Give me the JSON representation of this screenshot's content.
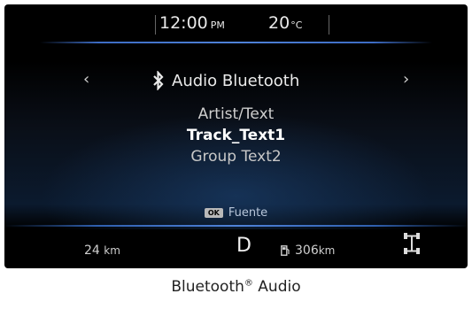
{
  "status_bar": {
    "time": "12:00",
    "ampm": "PM",
    "temperature": "20",
    "temp_unit": "°C"
  },
  "audio": {
    "nav_prev": "‹",
    "nav_next": "›",
    "source_icon": "bluetooth-icon",
    "source_title": "Audio Bluetooth",
    "artist": "Artist/Text",
    "track": "Track_Text1",
    "group": "Group Text2"
  },
  "hint": {
    "badge": "OK",
    "label": "Fuente"
  },
  "footer": {
    "distance_left": "24",
    "distance_left_unit": "km",
    "gear": "D",
    "fuel_icon": "fuel-pump-icon",
    "range": "306",
    "range_unit": "km",
    "drive_mode_icon": "awd-icon"
  },
  "caption": {
    "text": "Bluetooth",
    "sup": "®",
    "suffix": " Audio"
  },
  "colors": {
    "accent": "#4f82d8",
    "background": "#000000",
    "text": "#e9e9e9"
  }
}
